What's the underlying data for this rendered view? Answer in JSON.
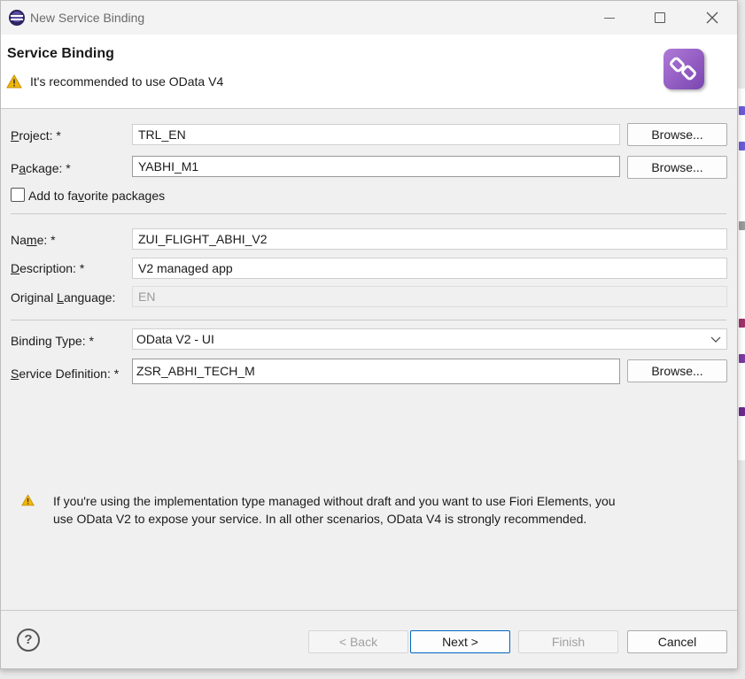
{
  "window": {
    "title": "New Service Binding"
  },
  "banner": {
    "title": "Service Binding",
    "message": "It's recommended to use OData V4"
  },
  "form": {
    "project": {
      "label_pre": "",
      "label_key": "P",
      "label_post": "roject: *",
      "value": "TRL_EN",
      "browse": "Browse..."
    },
    "package": {
      "label_pre": "P",
      "label_key": "a",
      "label_post": "ckage: *",
      "value": "YABHI_M1",
      "browse": "Browse..."
    },
    "favorite": {
      "label_pre": "Add to fa",
      "label_key": "v",
      "label_post": "orite packages",
      "checked": false
    },
    "name": {
      "label_pre": "Na",
      "label_key": "m",
      "label_post": "e: *",
      "value": "ZUI_FLIGHT_ABHI_V2"
    },
    "description": {
      "label_pre": "",
      "label_key": "D",
      "label_post": "escription: *",
      "value": "V2 managed app"
    },
    "language": {
      "label_pre": "Original ",
      "label_key": "L",
      "label_post": "anguage:",
      "value": "EN"
    },
    "binding_type": {
      "label": "Binding Type: *",
      "value": "OData V2 - UI"
    },
    "service_definition": {
      "label_pre": "",
      "label_key": "S",
      "label_post": "ervice Definition: *",
      "value": "ZSR_ABHI_TECH_M",
      "browse": "Browse..."
    }
  },
  "info_text": "If you're using the implementation type managed without draft and you want to use Fiori Elements, you use OData V2 to expose your service. In all other scenarios, OData V4 is strongly recommended.",
  "footer": {
    "back": "< Back",
    "next": "Next >",
    "finish": "Finish",
    "cancel": "Cancel",
    "help": "?"
  },
  "colors": {
    "accent": "#0067c0",
    "warning": "#f2b705",
    "wizard_icon": "#8b52c4"
  }
}
